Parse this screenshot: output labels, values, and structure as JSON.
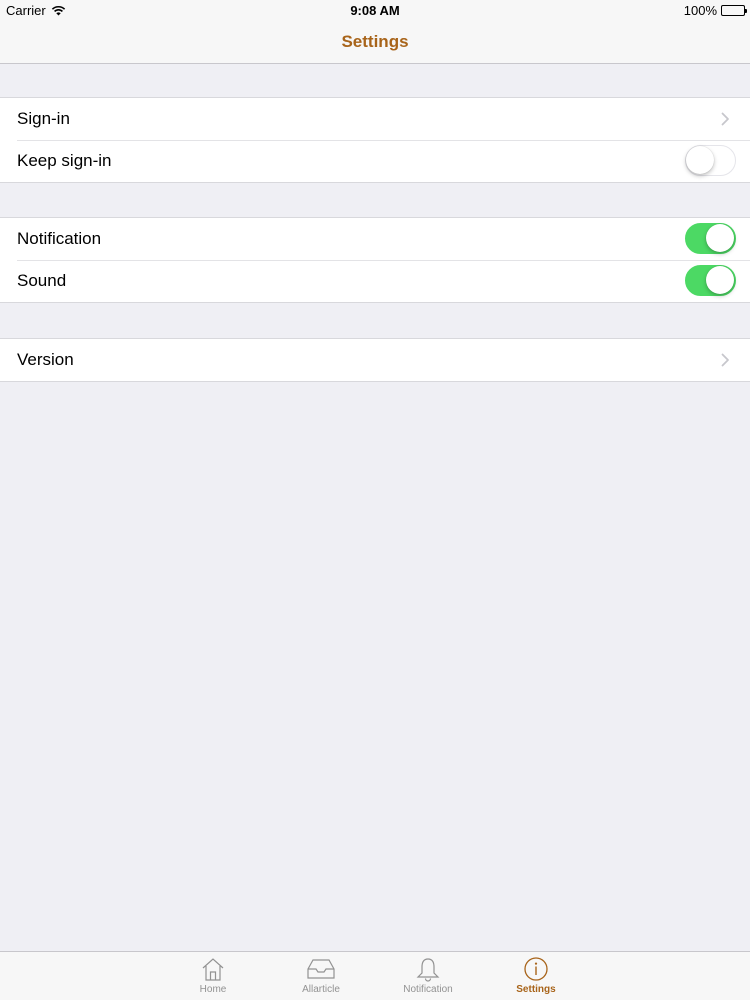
{
  "status_bar": {
    "carrier": "Carrier",
    "time": "9:08 AM",
    "battery": "100%"
  },
  "nav": {
    "title": "Settings",
    "accent_color": "#a8641a"
  },
  "groups": [
    {
      "rows": [
        {
          "label": "Sign-in",
          "accessory": "chevron"
        },
        {
          "label": "Keep sign-in",
          "accessory": "switch",
          "on": false
        }
      ]
    },
    {
      "rows": [
        {
          "label": "Notification",
          "accessory": "switch",
          "on": true
        },
        {
          "label": "Sound",
          "accessory": "switch",
          "on": true
        }
      ]
    },
    {
      "rows": [
        {
          "label": "Version",
          "accessory": "chevron"
        }
      ]
    }
  ],
  "switch_on_color": "#4cd964",
  "tabs": [
    {
      "label": "Home",
      "icon": "home-icon",
      "active": false
    },
    {
      "label": "Allarticle",
      "icon": "inbox-tray-icon",
      "active": false
    },
    {
      "label": "Notification",
      "icon": "bell-icon",
      "active": false
    },
    {
      "label": "Settings",
      "icon": "info-circle-icon",
      "active": true
    }
  ]
}
